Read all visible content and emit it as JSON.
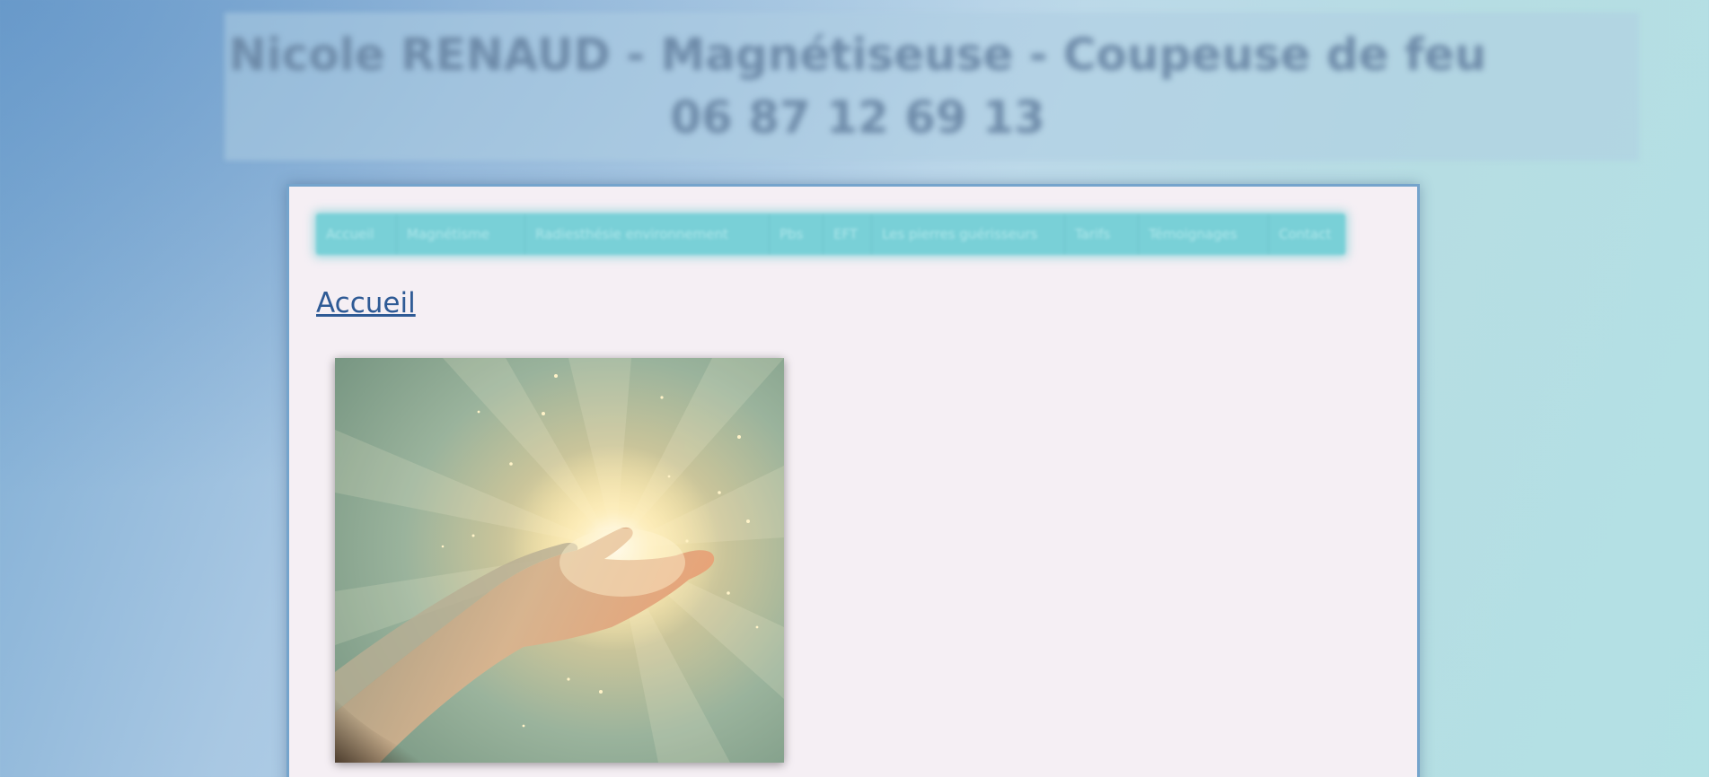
{
  "header": {
    "title_line1": "Nicole RENAUD - Magnétiseuse - Coupeuse de feu",
    "title_line2": "06 87 12 69 13"
  },
  "nav": {
    "items": [
      {
        "label": "Accueil"
      },
      {
        "label": "Magnétisme"
      },
      {
        "label": "Radiesthésie environnement"
      },
      {
        "label": "Pbs"
      },
      {
        "label": "EFT"
      },
      {
        "label": "Les pierres guérisseurs"
      },
      {
        "label": "Tarifs"
      },
      {
        "label": "Témoignages"
      },
      {
        "label": "Contact"
      }
    ]
  },
  "main": {
    "heading": "Accueil",
    "image_icon": "healing-hands-light-photo"
  },
  "colors": {
    "accent": "#75a4cc",
    "nav": "#79d0d7",
    "heading": "#2e5a95",
    "panel": "#f5eff4"
  }
}
